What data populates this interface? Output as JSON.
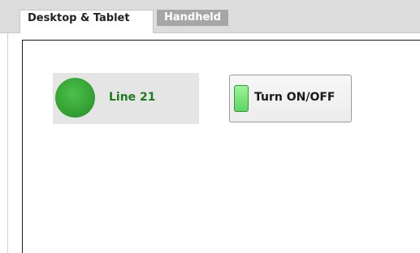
{
  "tabs": [
    {
      "label": "Desktop & Tablet",
      "active": true
    },
    {
      "label": "Handheld",
      "active": false
    }
  ],
  "indicator": {
    "label": "Line 21",
    "state": "on",
    "color": "#33a233"
  },
  "toggle_button": {
    "label": "Turn ON/OFF",
    "light_color": "#6ee06e"
  }
}
